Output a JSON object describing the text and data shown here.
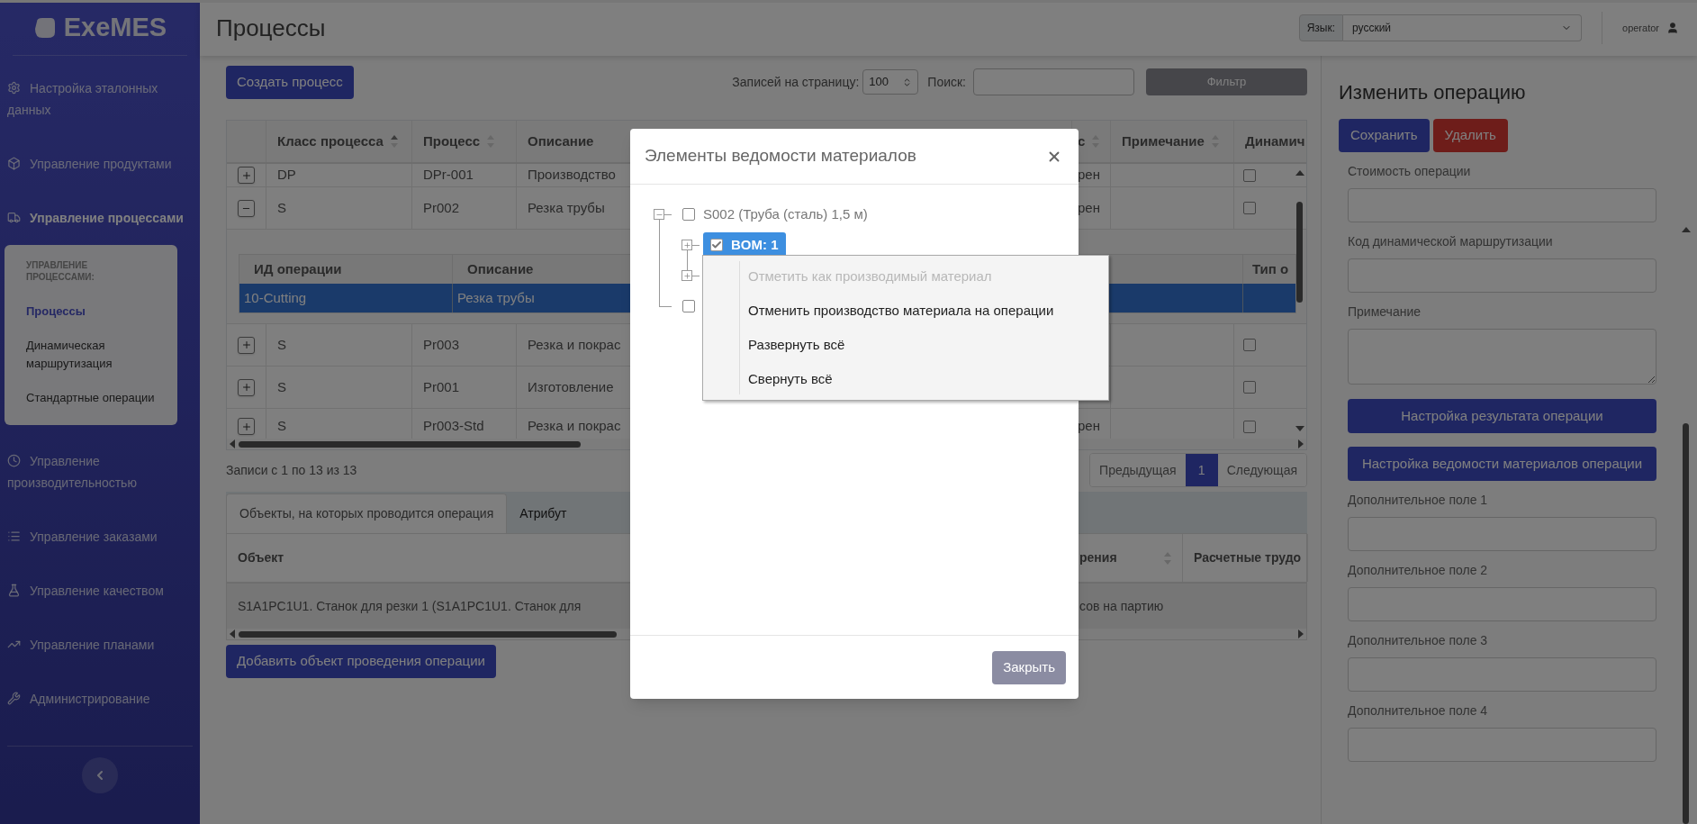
{
  "sidebar": {
    "logo": "ExeMES",
    "items": [
      {
        "label": "Настройка эталонных данных",
        "selected": false
      },
      {
        "label": "Управление продуктами",
        "selected": false
      },
      {
        "label": "Управление процессами",
        "selected": true,
        "submenu": {
          "heading": "УПРАВЛЕНИЕ ПРОЦЕССАМИ:",
          "items": [
            {
              "label": "Процессы",
              "selected": true
            },
            {
              "label": "Динамическая маршрутизация",
              "selected": false
            },
            {
              "label": "Стандартные операции",
              "selected": false
            }
          ]
        }
      },
      {
        "label": "Управление производительностью",
        "selected": false
      },
      {
        "label": "Управление заказами",
        "selected": false
      },
      {
        "label": "Управление качеством",
        "selected": false
      },
      {
        "label": "Управление планами",
        "selected": false
      },
      {
        "label": "Администрирование",
        "selected": false
      }
    ]
  },
  "header": {
    "title": "Процессы",
    "language_label": "Язык:",
    "language_value": "русский",
    "user": "operator"
  },
  "toolbar": {
    "create_button": "Создать процесс",
    "page_size_label": "Записей на страницу:",
    "page_size_value": "100",
    "search_label": "Поиск:",
    "filter_button": "Фильтр"
  },
  "table": {
    "columns": [
      {
        "label": "Класс процесса",
        "sorted": true
      },
      {
        "label": "Процесс",
        "sorted": false
      },
      {
        "label": "Описание"
      },
      {
        "label": "с",
        "sorted": false
      },
      {
        "label": "Примечание",
        "sorted": false
      },
      {
        "label": "Динамич"
      }
    ],
    "rows": [
      {
        "expanded": false,
        "class": "DP",
        "process": "DPr-001",
        "description": "Производство",
        "status": "рен",
        "dynamic": false
      },
      {
        "expanded": true,
        "class": "S",
        "process": "Pr002",
        "description": "Резка трубы",
        "status": "рен",
        "dynamic": false,
        "operations": {
          "columns": [
            "ИД операции",
            "Описание",
            "Тип о"
          ],
          "rows": [
            {
              "id": "10-Cutting",
              "description": "Резка трубы",
              "selected": true
            }
          ]
        }
      },
      {
        "expanded": false,
        "class": "S",
        "process": "Pr003",
        "description": "Резка и покрас",
        "dynamic": false
      },
      {
        "expanded": false,
        "class": "S",
        "process": "Pr001",
        "description": "Изготовление",
        "dynamic": false
      },
      {
        "expanded": false,
        "class": "S",
        "process": "Pr003-Std",
        "description": "Резка и покрас",
        "status": "рен",
        "dynamic": false
      }
    ]
  },
  "records_info": "Записи с 1 по 13 из 13",
  "pagination": {
    "prev": "Предыдущая",
    "pages": [
      {
        "label": "1",
        "selected": true
      }
    ],
    "next": "Следующая"
  },
  "bottom": {
    "tabs": [
      {
        "label": "Объекты, на которых проводится операция",
        "selected": true
      },
      {
        "label": "Атрибут",
        "selected": false
      }
    ],
    "columns": [
      {
        "label": "Объект"
      },
      {
        "label": "рения",
        "sorted": false
      },
      {
        "label": "Расчетные трудо"
      }
    ],
    "rows": [
      {
        "object": "S1A1PC1U1. Станок для резки 1 (S1A1PC1U1. Станок для",
        "column_2": "сов на партию"
      }
    ],
    "add_button": "Добавить объект проведения операции"
  },
  "edit_panel": {
    "title": "Изменить операцию",
    "save_button": "Сохранить",
    "delete_button": "Удалить",
    "fields": [
      {
        "label": "Стоимость операции",
        "kind": "input"
      },
      {
        "label": "Код динамической маршрутизации",
        "kind": "input"
      },
      {
        "label": "Примечание",
        "kind": "textarea"
      },
      {
        "label": "Настройка результата операции",
        "kind": "button"
      },
      {
        "label": "Настройка ведомости материалов операции",
        "kind": "button"
      },
      {
        "label": "Дополнительное поле 1",
        "kind": "input"
      },
      {
        "label": "Дополнительное поле 2",
        "kind": "input"
      },
      {
        "label": "Дополнительное поле 3",
        "kind": "input"
      },
      {
        "label": "Дополнительное поле 4",
        "kind": "input"
      }
    ]
  },
  "modal": {
    "title": "Элементы ведомости материалов",
    "close_button": "Закрыть",
    "tree": [
      {
        "label": "S002 (Труба (сталь) 1,5 м)",
        "checked": false,
        "expanded": true,
        "selected": false,
        "children": [
          {
            "label": "BOM: 1",
            "checked": true,
            "expanded": false,
            "selected": true
          },
          {
            "expanded": false
          }
        ]
      },
      {
        "checked": false,
        "selected": false
      }
    ]
  },
  "context_menu": [
    {
      "label": "Отметить как производимый материал",
      "disabled": true
    },
    {
      "label": "Отменить производство материала на операции",
      "disabled": false
    },
    {
      "label": "Развернуть всё",
      "disabled": false
    },
    {
      "label": "Свернуть всё",
      "disabled": false
    }
  ]
}
